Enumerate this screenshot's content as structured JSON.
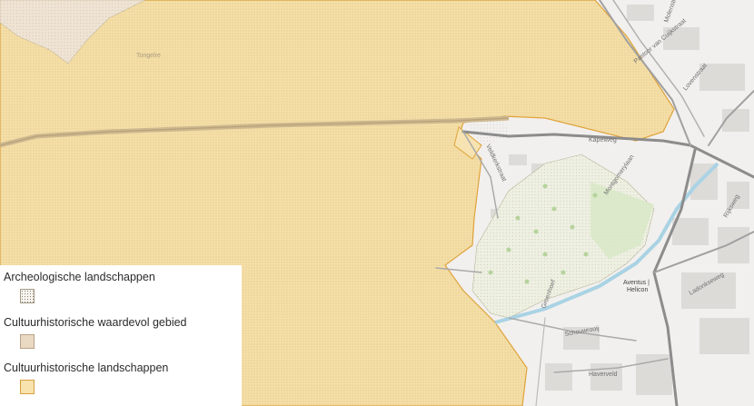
{
  "map": {
    "place_labels": [
      {
        "id": "tongelre",
        "text": "Tongelre"
      },
      {
        "id": "kapelweg",
        "text": "Kapelweg"
      },
      {
        "id": "montgomeryweg",
        "text": "Montgomerylaan"
      },
      {
        "id": "schouwrooij",
        "text": "Schouwrooij"
      },
      {
        "id": "haverveld",
        "text": "Haverveld"
      },
      {
        "id": "aventus",
        "text": "Aventus |"
      },
      {
        "id": "helicon",
        "text": "Helicon"
      },
      {
        "id": "ladonkseweg",
        "text": "Ladonkseweg"
      },
      {
        "id": "rijksweg",
        "text": "Rijksweg"
      },
      {
        "id": "pastoor",
        "text": "Pastoor van Cuijkstraat"
      },
      {
        "id": "molenstraat",
        "text": "Molenstraat"
      },
      {
        "id": "lovenstraat",
        "text": "Lovenstraat"
      },
      {
        "id": "groenhoef",
        "text": "Groenhoef"
      },
      {
        "id": "kerkstraat",
        "text": "Veldkerkstraat"
      }
    ]
  },
  "legend": {
    "items": [
      {
        "label": "Archeologische landschappen"
      },
      {
        "label": "Cultuurhistorische waardevol gebied"
      },
      {
        "label": "Cultuurhistorische landschappen"
      }
    ]
  },
  "colors": {
    "landscape_fill": "#f5dfa6",
    "landscape_border": "#e0a33b",
    "valuable_area_fill": "#ead9c2",
    "archaeology_fill": "#f7f4ef",
    "water": "#a9d3e4",
    "road": "#8c8c8c",
    "background": "#f2f0ee"
  }
}
